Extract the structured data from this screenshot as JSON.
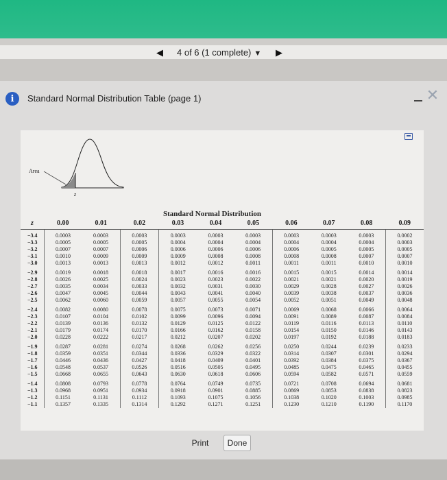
{
  "nav": {
    "prev_glyph": "◀",
    "counter": "4 of 6 (1 complete)",
    "caret": "▼",
    "next_glyph": "▶"
  },
  "dialog": {
    "info_glyph": "i",
    "title": "Standard Normal Distribution Table (page 1)",
    "close_glyph": "✕"
  },
  "figure": {
    "area_label": "Area",
    "z_label": "z",
    "table_title": "Standard Normal Distribution",
    "headers": [
      "z",
      "0.00",
      "0.01",
      "0.02",
      "0.03",
      "0.04",
      "0.05",
      "0.06",
      "0.07",
      "0.08",
      "0.09"
    ],
    "groups": [
      [
        [
          "−3.4",
          "0.0003",
          "0.0003",
          "0.0003",
          "0.0003",
          "0.0003",
          "0.0003",
          "0.0003",
          "0.0003",
          "0.0003",
          "0.0002"
        ],
        [
          "−3.3",
          "0.0005",
          "0.0005",
          "0.0005",
          "0.0004",
          "0.0004",
          "0.0004",
          "0.0004",
          "0.0004",
          "0.0004",
          "0.0003"
        ],
        [
          "−3.2",
          "0.0007",
          "0.0007",
          "0.0006",
          "0.0006",
          "0.0006",
          "0.0006",
          "0.0006",
          "0.0005",
          "0.0005",
          "0.0005"
        ],
        [
          "−3.1",
          "0.0010",
          "0.0009",
          "0.0009",
          "0.0009",
          "0.0008",
          "0.0008",
          "0.0008",
          "0.0008",
          "0.0007",
          "0.0007"
        ],
        [
          "−3.0",
          "0.0013",
          "0.0013",
          "0.0013",
          "0.0012",
          "0.0012",
          "0.0011",
          "0.0011",
          "0.0011",
          "0.0010",
          "0.0010"
        ]
      ],
      [
        [
          "−2.9",
          "0.0019",
          "0.0018",
          "0.0018",
          "0.0017",
          "0.0016",
          "0.0016",
          "0.0015",
          "0.0015",
          "0.0014",
          "0.0014"
        ],
        [
          "−2.8",
          "0.0026",
          "0.0025",
          "0.0024",
          "0.0023",
          "0.0023",
          "0.0022",
          "0.0021",
          "0.0021",
          "0.0020",
          "0.0019"
        ],
        [
          "−2.7",
          "0.0035",
          "0.0034",
          "0.0033",
          "0.0032",
          "0.0031",
          "0.0030",
          "0.0029",
          "0.0028",
          "0.0027",
          "0.0026"
        ],
        [
          "−2.6",
          "0.0047",
          "0.0045",
          "0.0044",
          "0.0043",
          "0.0041",
          "0.0040",
          "0.0039",
          "0.0038",
          "0.0037",
          "0.0036"
        ],
        [
          "−2.5",
          "0.0062",
          "0.0060",
          "0.0059",
          "0.0057",
          "0.0055",
          "0.0054",
          "0.0052",
          "0.0051",
          "0.0049",
          "0.0048"
        ]
      ],
      [
        [
          "−2.4",
          "0.0082",
          "0.0080",
          "0.0078",
          "0.0075",
          "0.0073",
          "0.0071",
          "0.0069",
          "0.0068",
          "0.0066",
          "0.0064"
        ],
        [
          "−2.3",
          "0.0107",
          "0.0104",
          "0.0102",
          "0.0099",
          "0.0096",
          "0.0094",
          "0.0091",
          "0.0089",
          "0.0087",
          "0.0084"
        ],
        [
          "−2.2",
          "0.0139",
          "0.0136",
          "0.0132",
          "0.0129",
          "0.0125",
          "0.0122",
          "0.0119",
          "0.0116",
          "0.0113",
          "0.0110"
        ],
        [
          "−2.1",
          "0.0179",
          "0.0174",
          "0.0170",
          "0.0166",
          "0.0162",
          "0.0158",
          "0.0154",
          "0.0150",
          "0.0146",
          "0.0143"
        ],
        [
          "−2.0",
          "0.0228",
          "0.0222",
          "0.0217",
          "0.0212",
          "0.0207",
          "0.0202",
          "0.0197",
          "0.0192",
          "0.0188",
          "0.0183"
        ]
      ],
      [
        [
          "−1.9",
          "0.0287",
          "0.0281",
          "0.0274",
          "0.0268",
          "0.0262",
          "0.0256",
          "0.0250",
          "0.0244",
          "0.0239",
          "0.0233"
        ],
        [
          "−1.8",
          "0.0359",
          "0.0351",
          "0.0344",
          "0.0336",
          "0.0329",
          "0.0322",
          "0.0314",
          "0.0307",
          "0.0301",
          "0.0294"
        ],
        [
          "−1.7",
          "0.0446",
          "0.0436",
          "0.0427",
          "0.0418",
          "0.0409",
          "0.0401",
          "0.0392",
          "0.0384",
          "0.0375",
          "0.0367"
        ],
        [
          "−1.6",
          "0.0548",
          "0.0537",
          "0.0526",
          "0.0516",
          "0.0505",
          "0.0495",
          "0.0485",
          "0.0475",
          "0.0465",
          "0.0455"
        ],
        [
          "−1.5",
          "0.0668",
          "0.0655",
          "0.0643",
          "0.0630",
          "0.0618",
          "0.0606",
          "0.0594",
          "0.0582",
          "0.0571",
          "0.0559"
        ]
      ],
      [
        [
          "−1.4",
          "0.0808",
          "0.0793",
          "0.0778",
          "0.0764",
          "0.0749",
          "0.0735",
          "0.0721",
          "0.0708",
          "0.0694",
          "0.0681"
        ],
        [
          "−1.3",
          "0.0968",
          "0.0951",
          "0.0934",
          "0.0918",
          "0.0901",
          "0.0885",
          "0.0869",
          "0.0853",
          "0.0838",
          "0.0823"
        ],
        [
          "−1.2",
          "0.1151",
          "0.1131",
          "0.1112",
          "0.1093",
          "0.1075",
          "0.1056",
          "0.1038",
          "0.1020",
          "0.1003",
          "0.0985"
        ],
        [
          "−1.1",
          "0.1357",
          "0.1335",
          "0.1314",
          "0.1292",
          "0.1271",
          "0.1251",
          "0.1230",
          "0.1210",
          "0.1190",
          "0.1170"
        ]
      ]
    ]
  },
  "footer": {
    "print_label": "Print",
    "done_label": "Done"
  }
}
